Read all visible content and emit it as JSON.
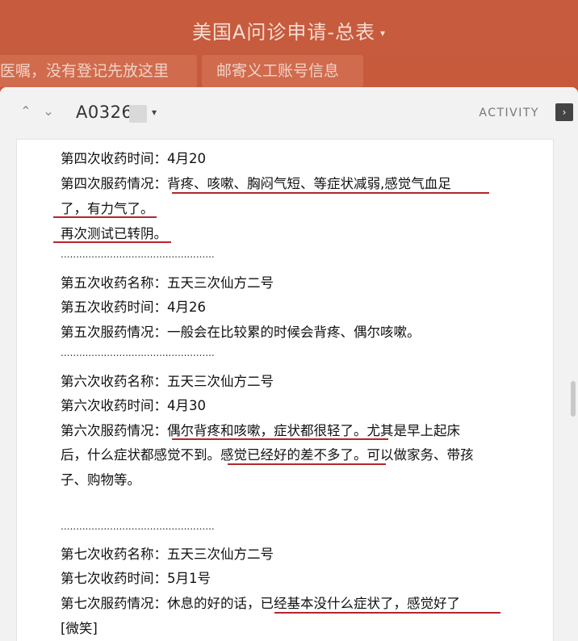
{
  "board": {
    "title": "美国A问诊申请-总表",
    "caret": "▾"
  },
  "lists": [
    {
      "label": "医嘱，没有登记先放这里"
    },
    {
      "label": "邮寄义工账号信息"
    }
  ],
  "card": {
    "id": "A0326",
    "caret": "▾",
    "activity_label": "ACTIVITY",
    "activity_icon": "›"
  },
  "nav": {
    "up": "⌃",
    "down": "⌄"
  },
  "notes": {
    "l1": "第四次收药时间：4月20",
    "l2": "第四次服药情况：背疼、咳嗽、胸闷气短、等症状减弱,感觉气血足",
    "l3": "了，有力气了。",
    "l4": "再次测试已转阴。",
    "sep": "..................................................",
    "l5": "第五次收药名称：五天三次仙方二号",
    "l6": "第五次收药时间：4月26",
    "l7": "第五次服药情况：一般会在比较累的时候会背疼、偶尔咳嗽。",
    "l8": "第六次收药名称：五天三次仙方二号",
    "l9": "第六次收药时间：4月30",
    "l10": "第六次服药情况：偶尔背疼和咳嗽，症状都很轻了。尤其是早上起床",
    "l11": "后，什么症状都感觉不到。感觉已经好的差不多了。可以做家务、带孩",
    "l12": "子、购物等。",
    "l13": "第七次收药名称：五天三次仙方二号",
    "l14": "第七次收药时间：5月1号",
    "l15": "第七次服药情况：休息的好的话，已经基本没什么症状了，感觉好了",
    "l16": "[微笑]"
  },
  "colors": {
    "board_bg": "#c65b3d",
    "list_bg": "#d06b4e",
    "underline": "#b3262a"
  }
}
